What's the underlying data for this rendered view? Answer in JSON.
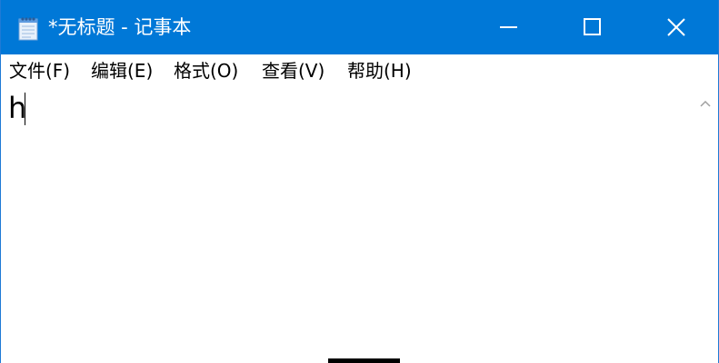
{
  "window": {
    "title": "*无标题 - 记事本",
    "title_bar_color": "#0078d7",
    "app_icon": "notepad-icon"
  },
  "controls": {
    "minimize_icon": "minimize-icon",
    "maximize_icon": "maximize-icon",
    "close_icon": "close-icon"
  },
  "menu": {
    "items": [
      {
        "label": "文件(F)"
      },
      {
        "label": "编辑(E)"
      },
      {
        "label": "格式(O)"
      },
      {
        "label": "查看(V)"
      },
      {
        "label": "帮助(H)"
      }
    ]
  },
  "editor": {
    "content": "h"
  },
  "scrollbar": {
    "up_icon": "chevron-up-icon"
  }
}
